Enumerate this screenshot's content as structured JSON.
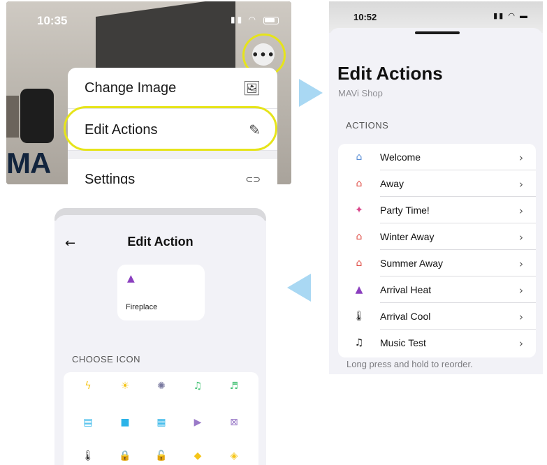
{
  "panel1": {
    "time": "10:35",
    "photo_brand_text": "MA",
    "more_button_label": "•••",
    "menu": [
      {
        "label": "Change Image",
        "icon": "image-icon",
        "glyph": "🖼"
      },
      {
        "label": "Edit Actions",
        "icon": "pencil-icon",
        "glyph": "✎"
      },
      {
        "label": "Settings",
        "icon": "toggle-icon",
        "glyph": "⊂⊃"
      }
    ]
  },
  "panel2": {
    "time": "10:52",
    "title": "Edit Actions",
    "subtitle": "MAVi Shop",
    "section": "ACTIONS",
    "actions": [
      {
        "label": "Welcome",
        "icon": "house-arrow-in-icon",
        "glyph": "⌂",
        "color": "#5b8fd6"
      },
      {
        "label": "Away",
        "icon": "house-arrow-out-icon",
        "glyph": "⌂",
        "color": "#e0514a"
      },
      {
        "label": "Party Time!",
        "icon": "party-popper-icon",
        "glyph": "✦",
        "color": "#d9458a"
      },
      {
        "label": "Winter Away",
        "icon": "house-arrow-out-icon",
        "glyph": "⌂",
        "color": "#e0514a"
      },
      {
        "label": "Summer Away",
        "icon": "house-arrow-out-icon",
        "glyph": "⌂",
        "color": "#e0514a"
      },
      {
        "label": "Arrival Heat",
        "icon": "fireplace-icon",
        "glyph": "▲",
        "color": "#8b3fbf"
      },
      {
        "label": "Arrival Cool",
        "icon": "thermometer-icon",
        "glyph": "🌡",
        "color": "#222222"
      },
      {
        "label": "Music Test",
        "icon": "music-list-icon",
        "glyph": "♫",
        "color": "#222222"
      }
    ],
    "chevron": "›",
    "hint": "Long press and hold to reorder."
  },
  "panel3": {
    "back": "←",
    "title": "Edit Action",
    "preview_label": "Fireplace",
    "preview_icon": "fireplace-icon",
    "section": "CHOOSE ICON",
    "icons": [
      {
        "name": "lightning-icon",
        "glyph": "ϟ",
        "color": "#f5c518"
      },
      {
        "name": "sun-icon",
        "glyph": "☀",
        "color": "#f5c518"
      },
      {
        "name": "bulb-icon",
        "glyph": "✺",
        "color": "#7a7aa0"
      },
      {
        "name": "music-note-icon",
        "glyph": "♫",
        "color": "#3cbf6e"
      },
      {
        "name": "music-off-icon",
        "glyph": "♬",
        "color": "#3cbf6e"
      },
      {
        "name": "window-blinds-icon",
        "glyph": "▤",
        "color": "#2bb3e8"
      },
      {
        "name": "shade-full-icon",
        "glyph": "■",
        "color": "#2bb3e8"
      },
      {
        "name": "shade-half-icon",
        "glyph": "▦",
        "color": "#2bb3e8"
      },
      {
        "name": "screen-play-icon",
        "glyph": "▶",
        "color": "#9a7ac8"
      },
      {
        "name": "screen-off-icon",
        "glyph": "⊠",
        "color": "#9a7ac8"
      },
      {
        "name": "thermometer-icon",
        "glyph": "🌡",
        "color": "#222222"
      },
      {
        "name": "lock-icon",
        "glyph": "🔒",
        "color": "#f5c518"
      },
      {
        "name": "unlock-icon",
        "glyph": "🔓",
        "color": "#f5c518"
      },
      {
        "name": "shield-check-icon",
        "glyph": "◆",
        "color": "#f5c518"
      },
      {
        "name": "shield-x-icon",
        "glyph": "◈",
        "color": "#f5c518"
      }
    ]
  }
}
